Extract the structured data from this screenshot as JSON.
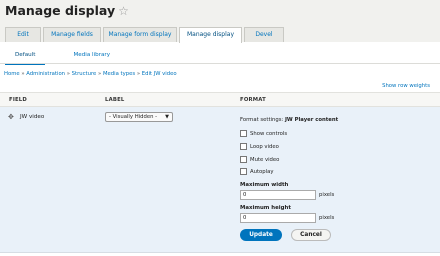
{
  "header": {
    "title": "Manage display",
    "star_icon": "star-outline-icon"
  },
  "tabs_primary": [
    {
      "label": "Edit",
      "active": false
    },
    {
      "label": "Manage fields",
      "active": false
    },
    {
      "label": "Manage form display",
      "active": false
    },
    {
      "label": "Manage display",
      "active": true
    },
    {
      "label": "Devel",
      "active": false
    }
  ],
  "tabs_secondary": [
    {
      "label": "Default",
      "active": true
    },
    {
      "label": "Media library",
      "active": false
    }
  ],
  "breadcrumb": [
    "Home",
    "Administration",
    "Structure",
    "Media types",
    "Edit JW video"
  ],
  "breadcrumb_separator": "»",
  "row_weights_link": "Show row weights",
  "table": {
    "headers": {
      "field": "FIELD",
      "label": "LABEL",
      "format": "FORMAT"
    },
    "row": {
      "field": "JW video",
      "label_value": "- Visually Hidden -",
      "format_settings_prefix": "Format settings:",
      "format_settings_name": "JW Player content",
      "checkboxes": [
        {
          "label": "Show controls",
          "checked": false
        },
        {
          "label": "Loop video",
          "checked": false
        },
        {
          "label": "Mute video",
          "checked": false
        },
        {
          "label": "Autoplay",
          "checked": false
        }
      ],
      "max_width": {
        "label": "Maximum width",
        "value": "0",
        "suffix": "pixels"
      },
      "max_height": {
        "label": "Maximum height",
        "value": "0",
        "suffix": "pixels"
      },
      "update_button": "Update",
      "cancel_button": "Cancel"
    }
  },
  "colors": {
    "link": "#0074bd",
    "row_highlight": "#e9f1f9",
    "primary_button": "#0074bd"
  }
}
